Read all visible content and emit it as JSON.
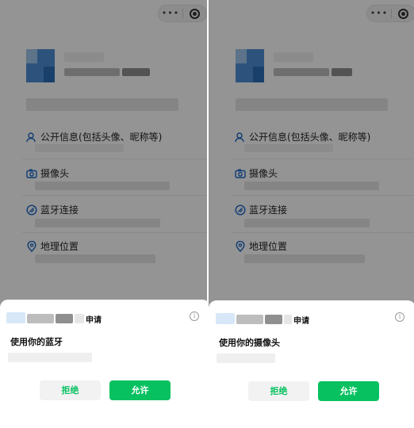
{
  "capsule": {
    "more_label": "•••"
  },
  "profile_permissions": [
    {
      "label": "公开信息(包括头像、昵称等)",
      "icon": "user-icon"
    },
    {
      "label": "摄像头",
      "icon": "camera-icon"
    },
    {
      "label": "蓝牙连接",
      "icon": "bluetooth-icon"
    },
    {
      "label": "地理位置",
      "icon": "location-pin-icon"
    }
  ],
  "left_sheet": {
    "app_suffix": "申请",
    "info_icon": "i",
    "request_text": "使用你的蓝牙",
    "reject_label": "拒绝",
    "allow_label": "允许"
  },
  "right_sheet": {
    "app_suffix": "申请",
    "info_icon": "i",
    "request_text": "使用你的摄像头",
    "reject_label": "拒绝",
    "allow_label": "允许"
  },
  "colors": {
    "accent_green": "#07c160",
    "icon_blue": "#1a66c6",
    "overlay": "rgba(0,0,0,0.42)"
  }
}
